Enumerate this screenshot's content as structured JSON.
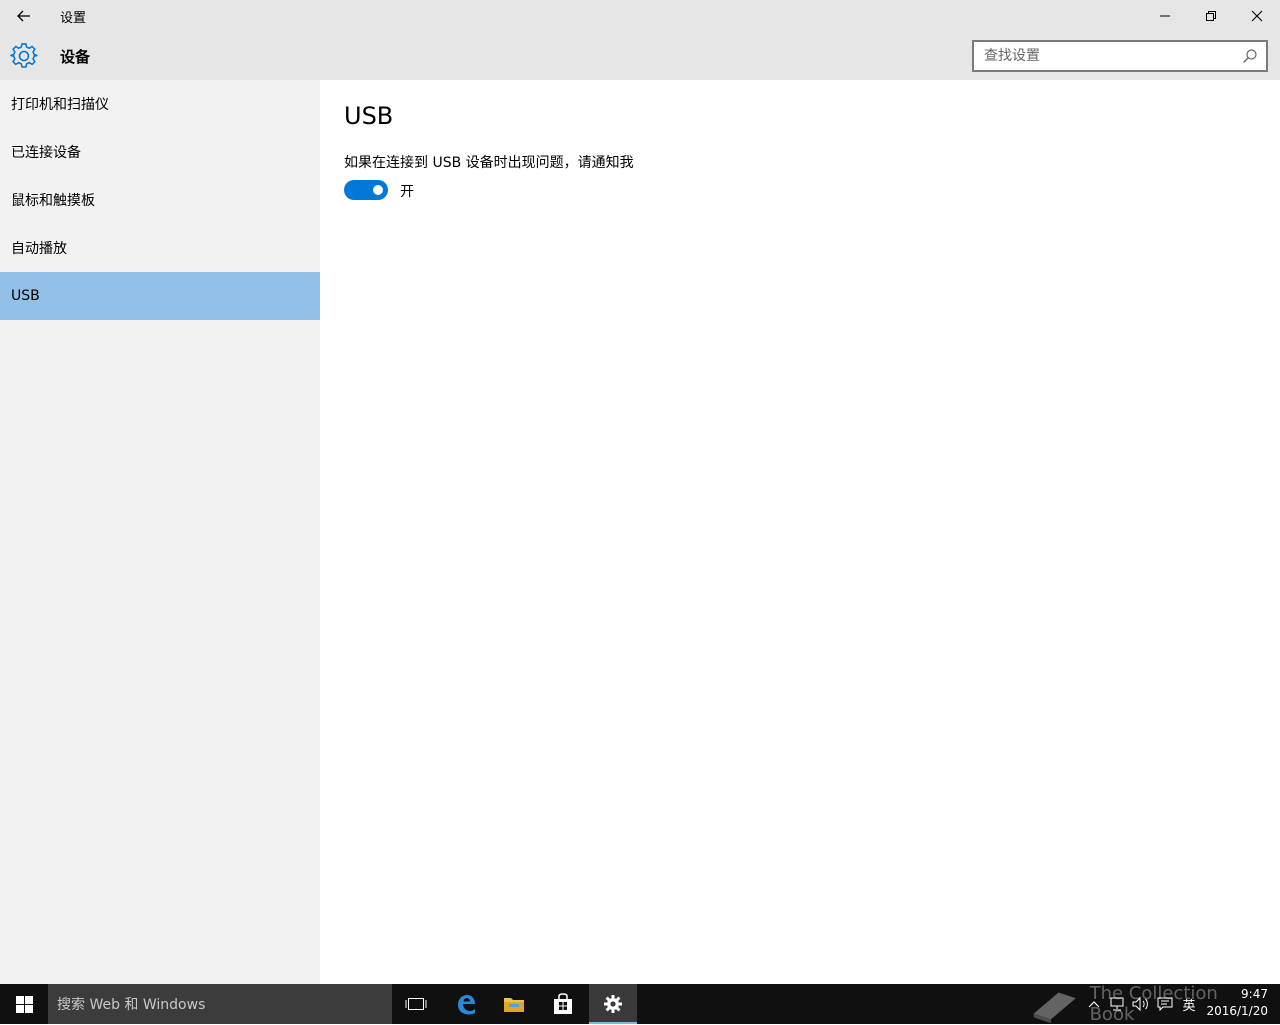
{
  "titlebar": {
    "title": "设置",
    "back_icon": "arrow-left-icon",
    "minimize_icon": "minimize-icon",
    "maximize_icon": "restore-icon",
    "close_icon": "close-icon"
  },
  "header": {
    "title": "设备",
    "icon": "gear-icon",
    "search": {
      "placeholder": "查找设置",
      "value": ""
    }
  },
  "sidebar": {
    "items": [
      {
        "label": "打印机和扫描仪"
      },
      {
        "label": "已连接设备"
      },
      {
        "label": "鼠标和触摸板"
      },
      {
        "label": "自动播放"
      },
      {
        "label": "USB"
      }
    ],
    "active_index": 4
  },
  "content": {
    "section_title": "USB",
    "setting_label": "如果在连接到 USB 设备时出现问题，请通知我",
    "toggle_on": true,
    "toggle_state": "开"
  },
  "taskbar": {
    "search_text": "搜索 Web 和 Windows",
    "watermark": "The Collection Book",
    "time": "9:47",
    "date": "2016/1/20",
    "ime": "英"
  },
  "colors": {
    "accent": "#0078d7",
    "active_nav": "#93c0e6",
    "chrome": "#e6e6e6",
    "sidebar": "#f2f2f2",
    "taskbar": "#101010"
  }
}
